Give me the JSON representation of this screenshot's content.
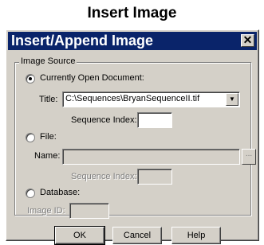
{
  "page_title": "Insert Image",
  "dialog": {
    "title": "Insert/Append Image",
    "close_glyph": "✕",
    "group_label": "Image Source",
    "options": {
      "open_doc": {
        "label": "Currently Open Document:",
        "checked": true
      },
      "file": {
        "label": "File:",
        "checked": false
      },
      "database": {
        "label": "Database:",
        "checked": false
      }
    },
    "title_label": "Title:",
    "title_value": "C:\\Sequences\\BryanSequenceII.tif",
    "sequence_index_label": "Sequence Index:",
    "sequence_index_value": "",
    "name_label": "Name:",
    "name_value": "",
    "browse_label": "...",
    "file_sequence_index_label": "Sequence Index:",
    "file_sequence_index_value": "",
    "image_id_label": "Image ID:",
    "image_id_value": "",
    "buttons": {
      "ok": "OK",
      "cancel": "Cancel",
      "help": "Help"
    },
    "icons": {
      "dropdown": "chevron-down-icon",
      "close": "close-icon"
    }
  }
}
